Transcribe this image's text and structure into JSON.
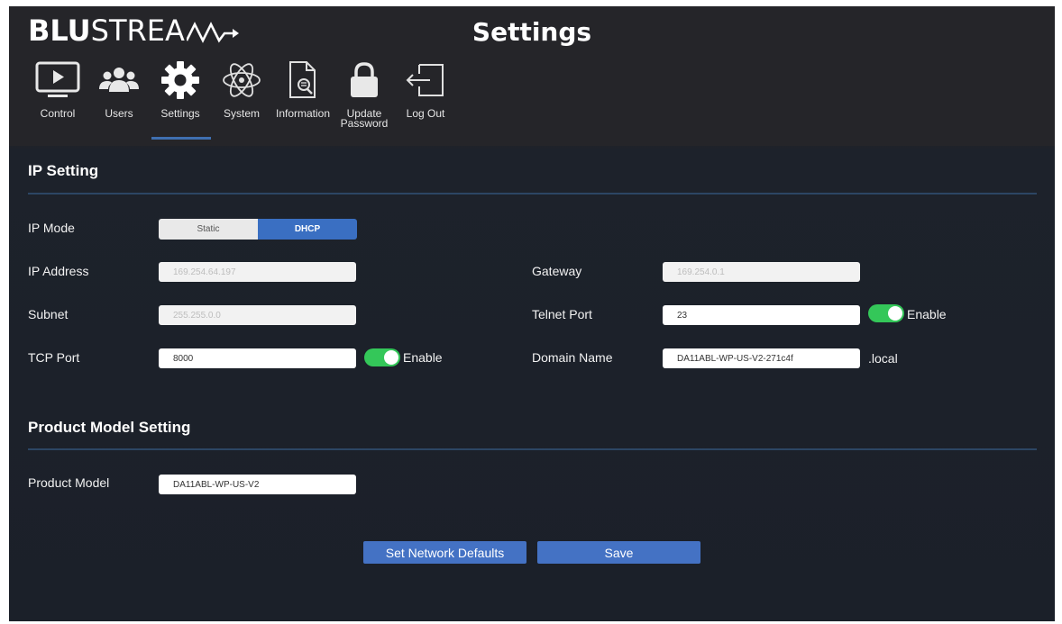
{
  "brand": {
    "logo_bold": "BLU",
    "logo_thin": "STREA"
  },
  "header": {
    "title": "Settings"
  },
  "nav": [
    {
      "label": "Control",
      "icon": "monitor-play-icon"
    },
    {
      "label": "Users",
      "icon": "users-icon"
    },
    {
      "label": "Settings",
      "icon": "gear-icon",
      "active": true
    },
    {
      "label": "System",
      "icon": "atom-icon"
    },
    {
      "label": "Information",
      "icon": "document-search-icon"
    },
    {
      "label": "Update Password",
      "icon": "lock-icon"
    },
    {
      "label": "Log Out",
      "icon": "logout-icon"
    }
  ],
  "ip_setting": {
    "title": "IP Setting",
    "ip_mode": {
      "label": "IP Mode",
      "options": [
        "Static",
        "DHCP"
      ],
      "selected": "DHCP"
    },
    "ip_address": {
      "label": "IP Address",
      "value": "169.254.64.197"
    },
    "gateway": {
      "label": "Gateway",
      "value": "169.254.0.1"
    },
    "subnet": {
      "label": "Subnet",
      "value": "255.255.0.0"
    },
    "telnet_port": {
      "label": "Telnet Port",
      "value": "23",
      "toggle_label": "Enable",
      "enabled": true
    },
    "tcp_port": {
      "label": "TCP Port",
      "value": "8000",
      "toggle_label": "Enable",
      "enabled": true
    },
    "domain_name": {
      "label": "Domain Name",
      "value": "DA11ABL-WP-US-V2-271c4f",
      "suffix": ".local"
    }
  },
  "product_model_setting": {
    "title": "Product Model Setting",
    "product_model": {
      "label": "Product Model",
      "value": "DA11ABL-WP-US-V2"
    }
  },
  "buttons": {
    "set_defaults": "Set Network Defaults",
    "save": "Save"
  },
  "colors": {
    "accent": "#3a6fc2",
    "toggle_on": "#34c759",
    "button": "#4472c4"
  }
}
